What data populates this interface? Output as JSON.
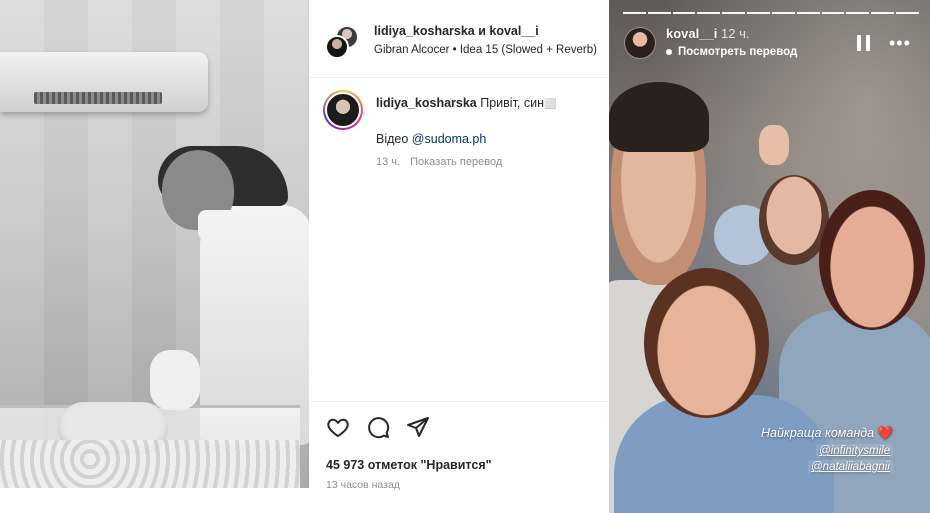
{
  "post": {
    "username_line": "lidiya_kosharska и koval__i",
    "audio": "Gibran Alcocer • Idea 15 (Slowed + Reverb)",
    "caption": {
      "user": "lidiya_kosharska",
      "text": "Привіт, син",
      "emoji": "⬜",
      "video_prefix": "Відео",
      "mention": "@sudoma.ph",
      "time_ago": "13 ч.",
      "translate": "Показать перевод"
    },
    "likes": "45 973 отметок \"Нравится\"",
    "time": "13 часов назад"
  },
  "icons": {
    "like": "heart-outline-icon",
    "comment": "comment-bubble-icon",
    "share": "paper-plane-icon",
    "pause": "pause-icon",
    "more": "more-dots-icon"
  },
  "story": {
    "username": "koval__i",
    "time": "12 ч.",
    "translate": "Посмотреть перевод",
    "more_glyph": "•••",
    "sticker_title": "Найкраща команда",
    "sticker_heart": "❤️",
    "mentions": [
      "@infinitysmile",
      "@nataliiabagnii"
    ],
    "segments": 12
  },
  "colors": {
    "text": "#262626",
    "secondary": "#8e8e8e",
    "mention": "#00376b"
  }
}
